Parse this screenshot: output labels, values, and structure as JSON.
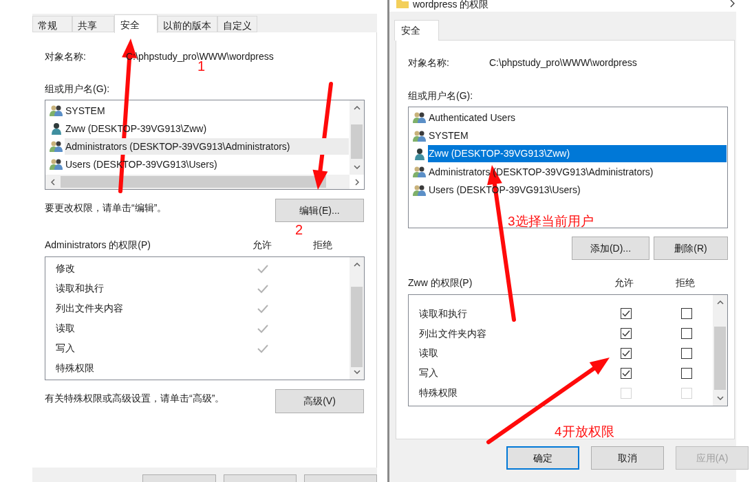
{
  "properties_window": {
    "tabs": [
      {
        "label": "常规",
        "selected": false
      },
      {
        "label": "共享",
        "selected": false
      },
      {
        "label": "安全",
        "selected": true
      },
      {
        "label": "以前的版本",
        "selected": false
      },
      {
        "label": "自定义",
        "selected": false
      }
    ],
    "object_name_label": "对象名称:",
    "object_name": "C:\\phpstudy_pro\\WWW\\wordpress",
    "group_label": "组或用户名(G):",
    "users": [
      {
        "name": "SYSTEM",
        "kind": "group",
        "selected": false
      },
      {
        "name": "Zww (DESKTOP-39VG913\\Zww)",
        "kind": "user",
        "selected": false
      },
      {
        "name": "Administrators (DESKTOP-39VG913\\Administrators)",
        "kind": "group",
        "selected": true
      },
      {
        "name": "Users (DESKTOP-39VG913\\Users)",
        "kind": "group",
        "selected": false
      }
    ],
    "edit_hint": "要更改权限，请单击“编辑”。",
    "edit_button": "编辑(E)...",
    "permissions_label": "Administrators 的权限(P)",
    "allow_header": "允许",
    "deny_header": "拒绝",
    "permissions": [
      {
        "name": "修改",
        "allow": true
      },
      {
        "name": "读取和执行",
        "allow": true
      },
      {
        "name": "列出文件夹内容",
        "allow": true
      },
      {
        "name": "读取",
        "allow": true
      },
      {
        "name": "写入",
        "allow": true
      },
      {
        "name": "特殊权限",
        "allow": false
      }
    ],
    "advanced_hint": "有关特殊权限或高级设置，请单击“高级”。",
    "advanced_button": "高级(V)"
  },
  "permissions_dialog": {
    "title": "wordpress 的权限",
    "tabs": [
      {
        "label": "安全",
        "selected": true
      }
    ],
    "object_name_label": "对象名称:",
    "object_name": "C:\\phpstudy_pro\\WWW\\wordpress",
    "group_label": "组或用户名(G):",
    "users": [
      {
        "name": "Authenticated Users",
        "kind": "group",
        "selected": false
      },
      {
        "name": "SYSTEM",
        "kind": "group",
        "selected": false
      },
      {
        "name": "Zww (DESKTOP-39VG913\\Zww)",
        "kind": "user",
        "selected": true
      },
      {
        "name": "Administrators (DESKTOP-39VG913\\Administrators)",
        "kind": "group",
        "selected": false
      },
      {
        "name": "Users (DESKTOP-39VG913\\Users)",
        "kind": "group",
        "selected": false
      }
    ],
    "add_button": "添加(D)...",
    "remove_button": "删除(R)",
    "permissions_label": "Zww 的权限(P)",
    "allow_header": "允许",
    "deny_header": "拒绝",
    "permissions": [
      {
        "name": "读取和执行",
        "allow": true,
        "deny": false,
        "disabled": false
      },
      {
        "name": "列出文件夹内容",
        "allow": true,
        "deny": false,
        "disabled": false
      },
      {
        "name": "读取",
        "allow": true,
        "deny": false,
        "disabled": false
      },
      {
        "name": "写入",
        "allow": true,
        "deny": false,
        "disabled": false
      },
      {
        "name": "特殊权限",
        "allow": false,
        "deny": false,
        "disabled": true
      }
    ],
    "buttons": [
      {
        "label": "确定",
        "default": true,
        "disabled": false
      },
      {
        "label": "取消",
        "default": false,
        "disabled": false
      },
      {
        "label": "应用(A)",
        "default": false,
        "disabled": true
      }
    ]
  },
  "annotations": [
    {
      "text": "1"
    },
    {
      "text": "2"
    },
    {
      "text": "3选择当前用户"
    },
    {
      "text": "4开放权限"
    }
  ]
}
